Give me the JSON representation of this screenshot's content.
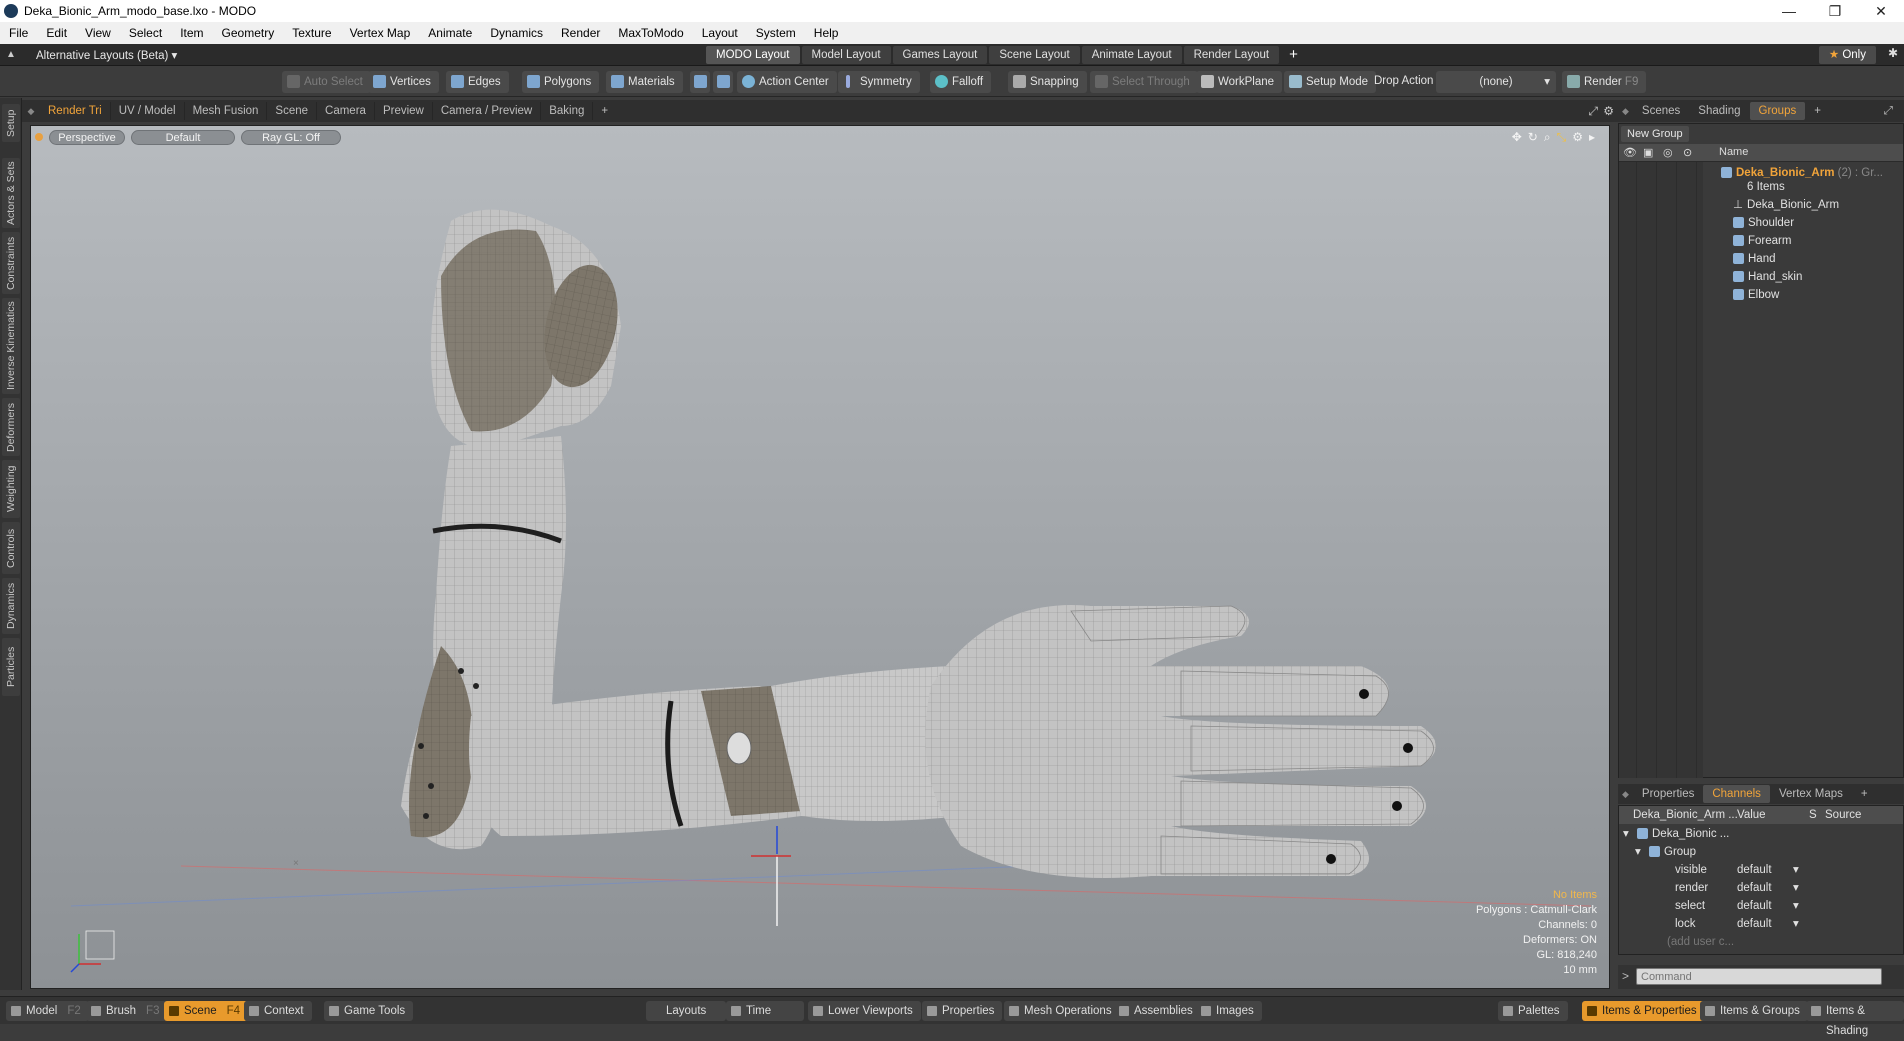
{
  "window": {
    "title": "Deka_Bionic_Arm_modo_base.lxo - MODO",
    "controls": [
      "—",
      "❐",
      "✕"
    ]
  },
  "menu": [
    "File",
    "Edit",
    "View",
    "Select",
    "Item",
    "Geometry",
    "Texture",
    "Vertex Map",
    "Animate",
    "Dynamics",
    "Render",
    "MaxToModo",
    "Layout",
    "System",
    "Help"
  ],
  "layouts": {
    "current": "Alternative Layouts (Beta)",
    "tabs": [
      "MODO Layout",
      "Model Layout",
      "Games Layout",
      "Scene Layout",
      "Animate Layout",
      "Render Layout"
    ],
    "active": "MODO Layout",
    "add": "+",
    "only": "Only"
  },
  "toolbar": {
    "auto_select": "Auto Select",
    "vertices": "Vertices",
    "edges": "Edges",
    "polygons": "Polygons",
    "materials": "Materials",
    "action_center": "Action Center",
    "symmetry": "Symmetry",
    "falloff": "Falloff",
    "snapping": "Snapping",
    "select_through": "Select Through",
    "workplane": "WorkPlane",
    "setup_mode": "Setup Mode",
    "drop_action_label": "Drop Action",
    "drop_action_value": "(none)",
    "render": "Render",
    "render_key": "F9"
  },
  "left_tabs": [
    "Setup",
    "Actors & Sets",
    "Constraints",
    "Inverse Kinematics",
    "Deformers",
    "Weighting",
    "Controls",
    "Dynamics",
    "Particles"
  ],
  "viewport_tabs": [
    "Render Tri",
    "UV / Model",
    "Mesh Fusion",
    "Scene",
    "Camera",
    "Preview",
    "Camera / Preview",
    "Baking"
  ],
  "viewport": {
    "view": "Perspective",
    "style": "Default",
    "raygl": "Ray GL: Off",
    "hud": {
      "items": "No Items",
      "polygons": "Polygons : Catmull-Clark",
      "channels": "Channels: 0",
      "deformers": "Deformers: ON",
      "gl": "GL: 818,240",
      "scale": "10 mm"
    }
  },
  "right_panel": {
    "tabs": [
      "Scenes",
      "Shading",
      "Groups"
    ],
    "active": "Groups",
    "new_group": "New Group",
    "column_name": "Name",
    "group_name": "Deka_Bionic_Arm",
    "group_suffix": "(2) : Gr...",
    "group_count": "6 Items",
    "items": [
      "Deka_Bionic_Arm",
      "Shoulder",
      "Forearm",
      "Hand",
      "Hand_skin",
      "Elbow"
    ]
  },
  "properties": {
    "tabs": [
      "Properties",
      "Channels",
      "Vertex Maps"
    ],
    "active": "Channels",
    "columns": [
      "Deka_Bionic_Arm ...",
      "Value",
      "S",
      "Source"
    ],
    "root": "Deka_Bionic ...",
    "group": "Group",
    "rows": [
      {
        "name": "visible",
        "value": "default"
      },
      {
        "name": "render",
        "value": "default"
      },
      {
        "name": "select",
        "value": "default"
      },
      {
        "name": "lock",
        "value": "default"
      }
    ],
    "add_user": "(add user c...",
    "command_placeholder": "Command"
  },
  "bottom": {
    "modes": [
      {
        "label": "Model",
        "key": "F2"
      },
      {
        "label": "Brush",
        "key": "F3"
      },
      {
        "label": "Scene",
        "key": "F4"
      },
      {
        "label": "Context",
        "key": ""
      },
      {
        "label": "Game Tools",
        "key": ""
      }
    ],
    "active_mode": "Scene",
    "middle": [
      "Layouts",
      "Time",
      "Lower Viewports",
      "Properties",
      "Mesh Operations",
      "Assemblies",
      "Images"
    ],
    "right": [
      "Palettes",
      "Items & Properties",
      "Items & Groups",
      "Items & Shading"
    ],
    "active_right": "Items & Properties"
  },
  "colors": {
    "accent_orange": "#f1a43a",
    "active_orange": "#e89a2c",
    "selection_blue": "#8fb3d8"
  }
}
